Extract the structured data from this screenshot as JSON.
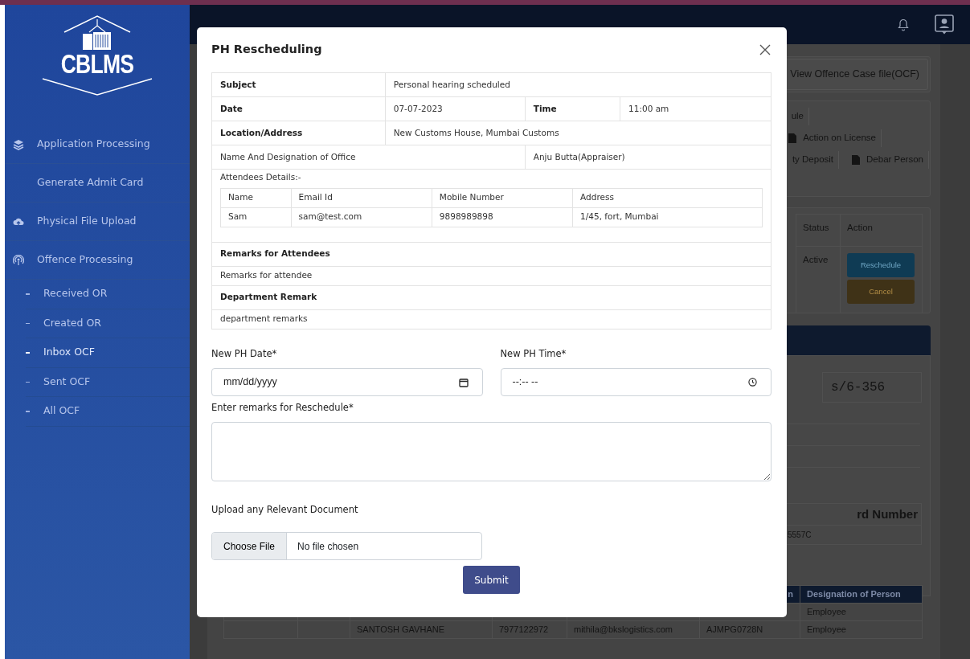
{
  "sidebar": {
    "logo": "CBLMS",
    "items": [
      {
        "label": "Application Processing",
        "kind": "heading"
      },
      {
        "label": "Generate Admit Card",
        "kind": "link"
      },
      {
        "label": "Physical File Upload",
        "kind": "heading"
      },
      {
        "label": "Offence Processing",
        "kind": "heading",
        "children": [
          {
            "label": "Received OR",
            "selected": false
          },
          {
            "label": "Created OR",
            "selected": false
          },
          {
            "label": "Inbox OCF",
            "selected": true
          },
          {
            "label": "Sent OCF",
            "selected": false
          },
          {
            "label": "All OCF",
            "selected": false
          }
        ]
      }
    ]
  },
  "page": {
    "view_ocf_button": "View Offence Case file(OCF)",
    "action_tabs": [
      [
        {
          "label": "ule",
          "icon": false
        }
      ],
      [
        {
          "label": "Action on License",
          "icon": true
        }
      ],
      [
        {
          "label": "ty Deposit",
          "icon": false
        },
        {
          "label": "Debar Person",
          "icon": true
        }
      ]
    ],
    "hearing_table": {
      "columns": [
        "Status",
        "Action"
      ],
      "rows": [
        {
          "status": "Active",
          "actions": [
            "Reschedule",
            "Cancel"
          ]
        }
      ]
    },
    "case_value": "s/6-356",
    "card_table": {
      "heading": "rd Number",
      "value": "5557C"
    },
    "persons_table": {
      "columns": [
        "n",
        "Designation of Person"
      ],
      "rows": [
        [
          "",
          "",
          "",
          "",
          "",
          "",
          "Employee"
        ],
        [
          "",
          "",
          "SANTOSH GAVHANE",
          "7977122972",
          "mithila@bkslogistics.com",
          "AJMPG0728N",
          "Employee"
        ]
      ]
    }
  },
  "modal": {
    "title": "PH Rescheduling",
    "details": {
      "subject": {
        "label": "Subject",
        "value": "Personal hearing scheduled"
      },
      "date": {
        "label": "Date",
        "value": "07-07-2023"
      },
      "time": {
        "label": "Time",
        "value": "11:00 am"
      },
      "location": {
        "label": "Location/Address",
        "value": "New Customs House, Mumbai Customs"
      },
      "officer": {
        "label": "Name And Designation of Office",
        "value": "Anju Butta(Appraiser)"
      },
      "attendees_label": "Attendees Details:-",
      "attendees": {
        "columns": [
          "Name",
          "Email Id",
          "Mobile Number",
          "Address"
        ],
        "rows": [
          [
            "Sam",
            "sam@test.com",
            "9898989898",
            "1/45, fort, Mumbai"
          ]
        ]
      },
      "remarks_attendees": {
        "label": "Remarks for Attendees",
        "value": "Remarks for attendee"
      },
      "department_remark": {
        "label": "Department Remark",
        "value": "department remarks"
      }
    },
    "form": {
      "date": {
        "label": "New PH Date*",
        "placeholder": "mm/dd/yyyy"
      },
      "time": {
        "label": "New PH Time*",
        "placeholder": "--:-- --"
      },
      "remarks": {
        "label": "Enter remarks for Reschedule*"
      },
      "upload": {
        "label": "Upload any Relevant Document",
        "button": "Choose File",
        "status": "No file chosen"
      },
      "submit": "Submit"
    }
  }
}
